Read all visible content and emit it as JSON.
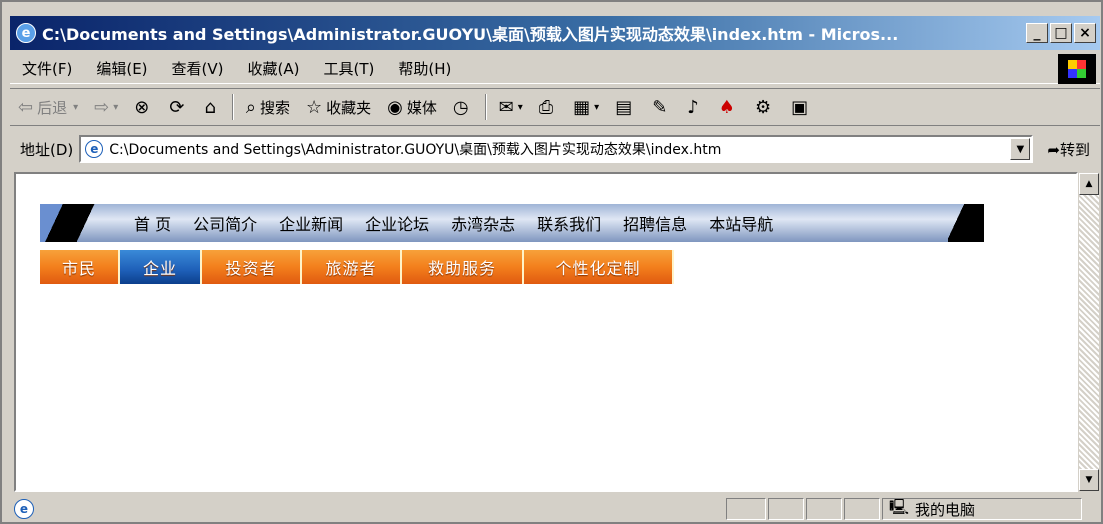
{
  "window": {
    "title": "C:\\Documents and Settings\\Administrator.GUOYU\\桌面\\预载入图片实现动态效果\\index.htm - Micros...",
    "buttons": {
      "minimize": "_",
      "maximize": "□",
      "close": "×"
    }
  },
  "menubar": {
    "items": [
      "文件(F)",
      "编辑(E)",
      "查看(V)",
      "收藏(A)",
      "工具(T)",
      "帮助(H)"
    ]
  },
  "toolbar": {
    "back": "后退",
    "search": "搜索",
    "favorites": "收藏夹",
    "media": "媒体"
  },
  "addressbar": {
    "label": "地址(D)",
    "value": "C:\\Documents and Settings\\Administrator.GUOYU\\桌面\\预载入图片实现动态效果\\index.htm",
    "go": "转到"
  },
  "page": {
    "nav1": [
      "首 页",
      "公司简介",
      "企业新闻",
      "企业论坛",
      "赤湾杂志",
      "联系我们",
      "招聘信息",
      "本站导航"
    ],
    "nav2": [
      {
        "label": "市民",
        "active": false
      },
      {
        "label": "企业",
        "active": true
      },
      {
        "label": "投资者",
        "active": false
      },
      {
        "label": "旅游者",
        "active": false
      },
      {
        "label": "救助服务",
        "active": false
      },
      {
        "label": "个性化定制",
        "active": false
      }
    ]
  },
  "statusbar": {
    "zone": "我的电脑"
  },
  "colors": {
    "title_start": "#0a246a",
    "title_end": "#a6caf0",
    "nav2_orange": "#f37f1c",
    "nav2_active_blue": "#1e5fb8"
  }
}
